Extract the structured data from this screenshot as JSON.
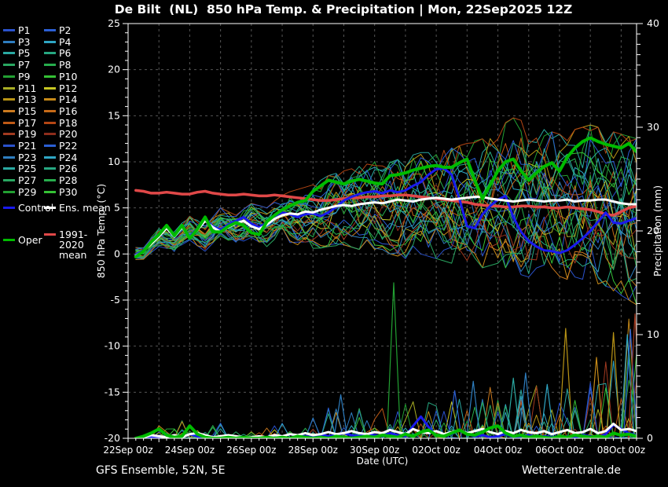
{
  "header": {
    "title": "De Bilt  (NL)  850 hPa Temp. & Precipitation | Mon, 22Sep2025 12Z"
  },
  "footer": {
    "left": "GFS Ensemble, 52N, 5E",
    "right": "Wetterzentrale.de"
  },
  "legend": {
    "members": [
      {
        "label": "P1",
        "color": "#2a52cc"
      },
      {
        "label": "P2",
        "color": "#2b5fd4"
      },
      {
        "label": "P3",
        "color": "#2e7ec0"
      },
      {
        "label": "P4",
        "color": "#2fa6c4"
      },
      {
        "label": "P5",
        "color": "#2aa9a2"
      },
      {
        "label": "P6",
        "color": "#27a882"
      },
      {
        "label": "P7",
        "color": "#29a761"
      },
      {
        "label": "P8",
        "color": "#27ad4d"
      },
      {
        "label": "P9",
        "color": "#22a032"
      },
      {
        "label": "P10",
        "color": "#35c135"
      },
      {
        "label": "P11",
        "color": "#a8ad24"
      },
      {
        "label": "P12",
        "color": "#c6c622"
      },
      {
        "label": "P13",
        "color": "#b99415"
      },
      {
        "label": "P14",
        "color": "#c78a18"
      },
      {
        "label": "P15",
        "color": "#cc7a1e"
      },
      {
        "label": "P16",
        "color": "#c66a18"
      },
      {
        "label": "P17",
        "color": "#c05a16"
      },
      {
        "label": "P18",
        "color": "#b44614"
      },
      {
        "label": "P19",
        "color": "#a23a20"
      },
      {
        "label": "P20",
        "color": "#8e2d1c"
      },
      {
        "label": "P21",
        "color": "#2a52cc"
      },
      {
        "label": "P22",
        "color": "#2b5fd4"
      },
      {
        "label": "P23",
        "color": "#2e7ec0"
      },
      {
        "label": "P24",
        "color": "#2fa6c4"
      },
      {
        "label": "P25",
        "color": "#2aa9a2"
      },
      {
        "label": "P26",
        "color": "#27a882"
      },
      {
        "label": "P27",
        "color": "#29a761"
      },
      {
        "label": "P28",
        "color": "#27ad4d"
      },
      {
        "label": "P29",
        "color": "#22a032"
      },
      {
        "label": "P30",
        "color": "#35c135"
      }
    ],
    "extras": [
      {
        "label": "Control",
        "color": "#1a1aee",
        "col": 0,
        "y": 265,
        "twoline": false
      },
      {
        "label": "Ens. mean",
        "color": "#ffffff",
        "col": 1,
        "y": 265,
        "twoline": false
      },
      {
        "label": "1991-2020 mean",
        "color": "#e04848",
        "col": 1,
        "y": 299,
        "twoline": true
      },
      {
        "label": "Oper",
        "color": "#00bb00",
        "col": 0,
        "y": 306,
        "twoline": false
      }
    ]
  },
  "chart_data": {
    "type": "line",
    "title": "De Bilt  (NL)  850 hPa Temp. & Precipitation | Mon, 22Sep2025 12Z",
    "x_axis": {
      "label": "Date (UTC)",
      "tick_labels": [
        "22Sep 00z",
        "24Sep 00z",
        "26Sep 00z",
        "28Sep 00z",
        "30Sep 00z",
        "02Oct 00z",
        "04Oct 00z",
        "06Oct 00z",
        "08Oct 00z"
      ],
      "tick_days": [
        0,
        2,
        4,
        6,
        8,
        10,
        12,
        14,
        16
      ],
      "range_days": [
        0,
        16.5
      ]
    },
    "y_axis_left": {
      "label": "850 hPa Temp. (°C)",
      "ticks": [
        25,
        20,
        15,
        10,
        5,
        0,
        -5,
        -10,
        -15,
        -20
      ],
      "range": [
        -20,
        25
      ]
    },
    "y_axis_right": {
      "label": "Precipitation (mm)",
      "ticks": [
        40,
        30,
        20,
        10,
        0
      ],
      "range": [
        0,
        40
      ]
    },
    "start_day": 0.25,
    "step_days": 0.25,
    "series": [
      {
        "name": "1991-2020 mean",
        "color": "#e04848",
        "width": 3.5,
        "temp": [
          6.9,
          6.8,
          6.6,
          6.6,
          6.7,
          6.6,
          6.5,
          6.5,
          6.7,
          6.8,
          6.6,
          6.5,
          6.4,
          6.4,
          6.5,
          6.4,
          6.3,
          6.3,
          6.4,
          6.3,
          6.2,
          6.1,
          6.0,
          5.9,
          5.8,
          5.8,
          5.9,
          6.0,
          6.1,
          6.1,
          6.2,
          6.2,
          6.3,
          6.3,
          6.4,
          6.4,
          6.3,
          6.2,
          6.1,
          6.0,
          5.9,
          5.8,
          5.7,
          5.6,
          5.4,
          5.3,
          5.2,
          5.2,
          5.1,
          5.1,
          5.2,
          5.2,
          5.1,
          5.1,
          5.0,
          5.0,
          5.1,
          5.0,
          4.9,
          4.8,
          4.6,
          4.3,
          4.2,
          4.6,
          5.0,
          5.2
        ]
      },
      {
        "name": "Control",
        "color": "#1a1aee",
        "width": 3,
        "temp": [
          -0.1,
          0.4,
          1.2,
          2.0,
          2.9,
          2.0,
          3.0,
          1.9,
          2.8,
          3.8,
          3.0,
          2.6,
          3.2,
          3.6,
          4.0,
          3.3,
          2.9,
          3.4,
          4.1,
          4.5,
          4.3,
          4.0,
          4.3,
          4.4,
          4.1,
          4.5,
          5.1,
          5.8,
          6.2,
          6.5,
          6.7,
          6.8,
          6.6,
          6.9,
          6.7,
          6.9,
          7.4,
          7.8,
          8.6,
          9.2,
          9.3,
          8.6,
          6.0,
          3.0,
          2.8,
          4.3,
          5.2,
          5.9,
          6.3,
          4.0,
          2.4,
          1.4,
          0.8,
          0.4,
          0.3,
          0.1,
          0.4,
          1.0,
          1.7,
          2.5,
          3.5,
          4.5,
          3.4,
          3.3,
          3.6,
          3.9
        ],
        "precip": [
          0,
          0,
          0.1,
          0,
          0,
          0.2,
          0.1,
          0.4,
          0.2,
          0,
          0,
          0.1,
          0,
          0.1,
          0,
          0,
          0.1,
          0,
          0.2,
          0.1,
          0,
          0.3,
          0.2,
          0.1,
          0.4,
          0.2,
          0.3,
          0.5,
          0.3,
          0.2,
          0.4,
          0.3,
          0.2,
          0.5,
          0.3,
          0.2,
          1.2,
          2.1,
          1.1,
          0.3,
          0.2,
          0.4,
          0.8,
          0.4,
          0.2,
          0.3,
          0.1,
          0.2,
          0.4,
          0.1,
          0.2,
          0.3,
          0.1,
          0.2,
          0.1,
          0,
          0.2,
          0.1,
          0.3,
          0.2,
          0.1,
          0.4,
          1.3,
          0.9,
          0.5,
          0.3
        ]
      },
      {
        "name": "Ens. mean",
        "color": "#ffffff",
        "width": 3,
        "temp": [
          -0.2,
          0.3,
          1.1,
          1.9,
          2.8,
          1.9,
          2.9,
          1.8,
          2.6,
          3.6,
          2.9,
          2.4,
          2.9,
          3.3,
          3.6,
          3.0,
          2.7,
          3.2,
          3.8,
          4.2,
          4.4,
          4.3,
          4.6,
          4.5,
          4.8,
          5.0,
          5.2,
          5.3,
          5.2,
          5.4,
          5.5,
          5.6,
          5.5,
          5.7,
          5.9,
          5.8,
          5.7,
          5.9,
          6.0,
          6.1,
          6.0,
          5.9,
          6.0,
          6.1,
          6.2,
          6.2,
          6.0,
          5.9,
          5.8,
          5.7,
          5.8,
          5.9,
          5.8,
          5.7,
          5.8,
          5.8,
          5.9,
          5.7,
          5.8,
          5.8,
          5.9,
          5.9,
          5.7,
          5.5,
          5.4,
          5.4
        ],
        "precip": [
          0,
          0.1,
          0.3,
          0.2,
          0.1,
          0.3,
          0.1,
          0.4,
          0.5,
          0.3,
          0.1,
          0.2,
          0.3,
          0.2,
          0.1,
          0.1,
          0.2,
          0.1,
          0.3,
          0.2,
          0.4,
          0.3,
          0.5,
          0.3,
          0.4,
          0.6,
          0.4,
          0.5,
          0.7,
          0.5,
          0.4,
          0.6,
          0.5,
          0.8,
          0.6,
          0.4,
          0.9,
          0.6,
          0.5,
          0.7,
          0.4,
          0.6,
          0.8,
          0.5,
          0.7,
          0.9,
          0.6,
          0.4,
          0.7,
          0.5,
          0.8,
          0.6,
          0.5,
          0.7,
          0.4,
          0.6,
          0.8,
          0.5,
          0.6,
          0.9,
          0.5,
          0.7,
          1.4,
          0.8,
          0.9,
          0.7
        ]
      },
      {
        "name": "Oper",
        "color": "#00bb00",
        "width": 4,
        "temp": [
          -0.3,
          0.3,
          1.3,
          2.1,
          3.1,
          2.0,
          3.1,
          1.7,
          2.7,
          4.0,
          2.4,
          2.4,
          3.0,
          3.4,
          3.1,
          2.3,
          2.1,
          3.5,
          4.2,
          4.8,
          5.2,
          5.6,
          5.8,
          6.8,
          7.4,
          8.0,
          7.8,
          7.6,
          7.9,
          8.1,
          7.9,
          7.7,
          7.6,
          8.5,
          8.6,
          8.8,
          9.1,
          9.3,
          9.5,
          9.6,
          9.4,
          9.4,
          9.9,
          10.3,
          8.0,
          6.0,
          7.5,
          9.0,
          10.0,
          10.3,
          9.0,
          8.0,
          8.8,
          9.5,
          9.9,
          9.0,
          10.5,
          11.5,
          12.2,
          12.6,
          12.2,
          11.9,
          11.7,
          11.5,
          12.0,
          11.1
        ],
        "precip": [
          0,
          0.2,
          0.5,
          0.9,
          0.3,
          0.1,
          0.2,
          1.2,
          0.4,
          0.1,
          0,
          0,
          0.1,
          0,
          0.1,
          0,
          0,
          0.1,
          0,
          0.1,
          0,
          0.2,
          0.1,
          0,
          0.1,
          0,
          0.2,
          0.1,
          0,
          0.1,
          0.2,
          0.1,
          0.3,
          0.2,
          0.1,
          0.4,
          0.2,
          0.6,
          0.8,
          0.3,
          0.2,
          0.5,
          0.8,
          0.4,
          0.3,
          0.6,
          1.0,
          1.2,
          0.5,
          0.2,
          0.3,
          0.1,
          0.2,
          0.1,
          0,
          0.2,
          0.1,
          0.3,
          0.2,
          0.1,
          0.2,
          0.1,
          0.5,
          0.3,
          0.4,
          0.2
        ]
      }
    ],
    "ensemble_envelope": {
      "start_day": 0.5,
      "step_days": 0.5,
      "temp_min": [
        -0.6,
        0.8,
        0.0,
        1.5,
        0.3,
        2.0,
        1.0,
        1.8,
        0.8,
        1.5,
        1.0,
        0.5,
        0.8,
        1.0,
        0.5,
        0.5,
        0.0,
        -0.5,
        0.0,
        -0.5,
        -1.0,
        -1.0,
        -1.5,
        -1.0,
        -2.0,
        -2.5,
        -2.0,
        -3.0,
        -2.5,
        -3.0,
        -3.5,
        -4.5,
        -5.5
      ],
      "temp_max": [
        0.7,
        3.0,
        2.4,
        4.3,
        3.0,
        5.0,
        4.2,
        5.5,
        5.0,
        6.5,
        7.0,
        7.5,
        8.5,
        9.0,
        9.5,
        10.0,
        10.0,
        10.5,
        11.0,
        11.0,
        11.5,
        12.0,
        12.5,
        13.5,
        15.0,
        14.0,
        13.5,
        13.0,
        13.5,
        14.0,
        13.5,
        13.0,
        12.5
      ],
      "precip_max": [
        0.5,
        1.5,
        1.0,
        2.5,
        1.0,
        1.5,
        0.8,
        0.8,
        1.0,
        1.5,
        1.2,
        2.0,
        3.0,
        3.5,
        4.5,
        3.0,
        5.0,
        5.0,
        4.0,
        4.5,
        5.5,
        6.5,
        5.0,
        6.0,
        5.0,
        5.5,
        6.0,
        8.0,
        6.0,
        7.0,
        8.0,
        10.0,
        14.0
      ]
    },
    "notable_precip_spikes": [
      {
        "day": 6.9,
        "mm": 4.2,
        "color": "#2e7ec0"
      },
      {
        "day": 8.62,
        "mm": 15.0,
        "color": "#22a032"
      },
      {
        "day": 10.6,
        "mm": 4.6,
        "color": "#2b5fd4"
      },
      {
        "day": 11.2,
        "mm": 5.5,
        "color": "#2e7ec0"
      },
      {
        "day": 12.5,
        "mm": 5.8,
        "color": "#2aa9a2"
      },
      {
        "day": 12.9,
        "mm": 6.3,
        "color": "#2e7ec0"
      },
      {
        "day": 13.6,
        "mm": 5.2,
        "color": "#2fa6c4"
      },
      {
        "day": 14.2,
        "mm": 10.6,
        "color": "#b99415"
      },
      {
        "day": 15.2,
        "mm": 7.8,
        "color": "#c78a18"
      },
      {
        "day": 15.75,
        "mm": 10.2,
        "color": "#b99415"
      },
      {
        "day": 16.2,
        "mm": 10.0,
        "color": "#2fa6c4"
      },
      {
        "day": 16.3,
        "mm": 10.5,
        "color": "#2b5fd4"
      },
      {
        "day": 16.45,
        "mm": 12.0,
        "color": "#a23a20"
      }
    ]
  }
}
